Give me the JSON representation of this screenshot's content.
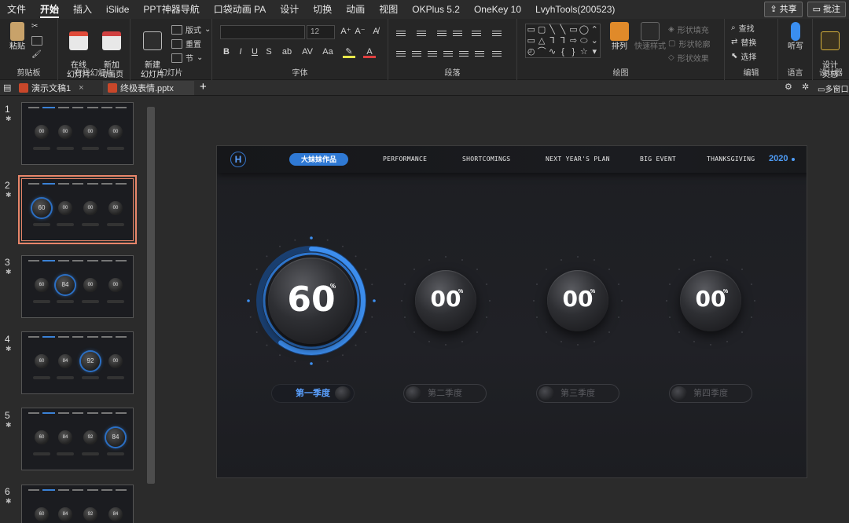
{
  "menubar": {
    "items": [
      "文件",
      "开始",
      "插入",
      "iSlide",
      "PPT神器导航",
      "口袋动画 PA",
      "设计",
      "切换",
      "动画",
      "视图",
      "OKPlus 5.2",
      "OneKey 10",
      "LvyhTools(200523)"
    ],
    "active_index": 1,
    "share_label": "共享",
    "comment_label": "批注"
  },
  "ribbon": {
    "clipboard": {
      "paste": "粘贴",
      "label": "剪贴板"
    },
    "online": {
      "online_slide": "在线\n幻灯片",
      "new_anim": "新加\n动画页",
      "label": "在线幻灯片"
    },
    "slides": {
      "new_slide": "新建\n幻灯片",
      "layout": "版式",
      "reset": "重置",
      "section": "节",
      "label": "幻灯片"
    },
    "font": {
      "size": "12",
      "label": "字体",
      "bold": "B",
      "italic": "I",
      "underline": "U",
      "strike": "S",
      "spacing": "AV",
      "case": "Aa"
    },
    "paragraph": {
      "label": "段落"
    },
    "drawing": {
      "arrange": "排列",
      "quick_style": "快速样式",
      "fill": "形状填充",
      "outline": "形状轮廓",
      "effect": "形状效果",
      "label": "绘图"
    },
    "editing": {
      "find": "查找",
      "replace": "替换",
      "select": "选择",
      "label": "编辑"
    },
    "voice": {
      "dictate": "听写",
      "label": "语言"
    },
    "designer": {
      "idea": "设计\n灵感",
      "label": "设计器"
    }
  },
  "tabs": [
    {
      "title": "演示文稿1"
    },
    {
      "title": "终极表情.pptx"
    }
  ],
  "tab_right": "多窗口",
  "thumbnails": [
    {
      "num": "1",
      "values": [
        "00",
        "00",
        "00",
        "00"
      ],
      "active": -1
    },
    {
      "num": "2",
      "values": [
        "60",
        "00",
        "00",
        "00"
      ],
      "active": 0
    },
    {
      "num": "3",
      "values": [
        "60",
        "84",
        "00",
        "00"
      ],
      "active": 1
    },
    {
      "num": "4",
      "values": [
        "60",
        "84",
        "92",
        "00"
      ],
      "active": 2
    },
    {
      "num": "5",
      "values": [
        "60",
        "84",
        "92",
        "84"
      ],
      "active": 3
    },
    {
      "num": "6",
      "values": [
        "60",
        "84",
        "92",
        "84"
      ],
      "active": -1
    }
  ],
  "slide": {
    "logo": "H",
    "nav": {
      "active": "大妹妹作品",
      "links": [
        "PERFORMANCE",
        "SHORTCOMINGS",
        "NEXT YEAR'S PLAN",
        "BIG EVENT",
        "THANKSGIVING"
      ],
      "year": "2020"
    },
    "gauges": [
      {
        "value": "60",
        "unit": "%",
        "label": "第一季度",
        "progress": 0.6,
        "active": true
      },
      {
        "value": "00",
        "unit": "%",
        "label": "第二季度",
        "progress": 0,
        "active": false
      },
      {
        "value": "00",
        "unit": "%",
        "label": "第三季度",
        "progress": 0,
        "active": false
      },
      {
        "value": "00",
        "unit": "%",
        "label": "第四季度",
        "progress": 0,
        "active": false
      }
    ]
  },
  "colors": {
    "accent": "#2f79d4",
    "selection": "#e8866a",
    "share": "#ffffff"
  }
}
